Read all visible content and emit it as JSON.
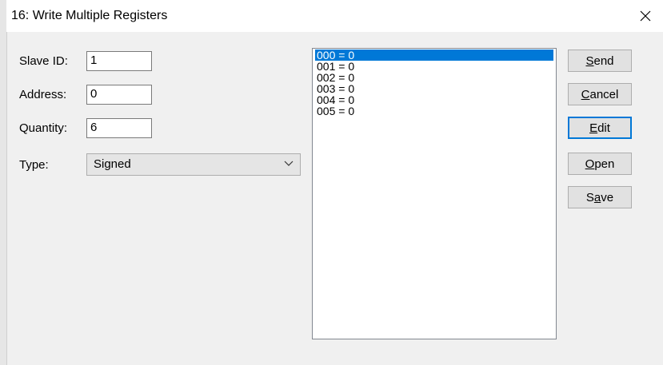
{
  "window": {
    "title": "16: Write Multiple Registers",
    "close_icon": "close-icon"
  },
  "form": {
    "slave_id_label": "Slave ID:",
    "slave_id_value": "1",
    "address_label": "Address:",
    "address_value": "0",
    "quantity_label": "Quantity:",
    "quantity_value": "6",
    "type_label": "Type:",
    "type_value": "Signed"
  },
  "registers": [
    "000 = 0",
    "001 = 0",
    "002 = 0",
    "003 = 0",
    "004 = 0",
    "005 = 0"
  ],
  "buttons": {
    "send": {
      "pre": "",
      "key": "S",
      "post": "end"
    },
    "cancel": {
      "pre": "",
      "key": "C",
      "post": "ancel"
    },
    "edit": {
      "pre": "",
      "key": "E",
      "post": "dit"
    },
    "open": {
      "pre": "",
      "key": "O",
      "post": "pen"
    },
    "save": {
      "pre": "S",
      "key": "a",
      "post": "ve"
    }
  },
  "colors": {
    "selection": "#0078d7",
    "dialog_bg": "#f0f0f0"
  }
}
